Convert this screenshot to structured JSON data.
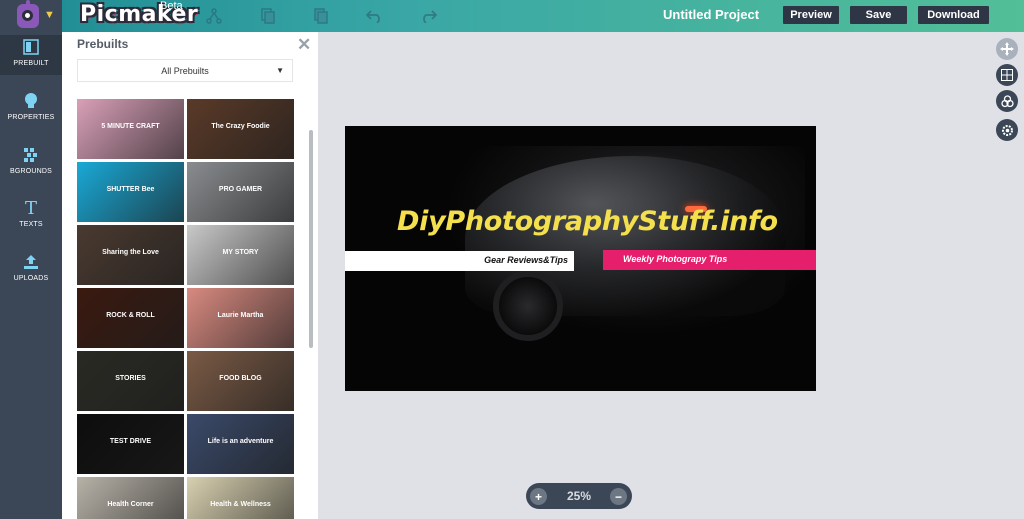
{
  "app": {
    "brand": "Picmaker",
    "badge": "Beta",
    "project_title": "Untitled Project",
    "accent_color": "#52bf98",
    "brand_color": "#3b4756"
  },
  "toolbar": {
    "icons": [
      "share-icon",
      "copy-icon",
      "duplicate-icon",
      "undo-icon",
      "redo-icon"
    ],
    "preview_label": "Preview",
    "save_label": "Save",
    "download_label": "Download"
  },
  "rail": {
    "items": [
      {
        "label": "PREBUILT",
        "icon": "layout-icon",
        "active": true
      },
      {
        "label": "PROPERTIES",
        "icon": "bulb-icon",
        "active": false
      },
      {
        "label": "BGROUNDS",
        "icon": "pattern-icon",
        "active": false
      },
      {
        "label": "TEXTS",
        "icon": "text-icon",
        "active": false
      },
      {
        "label": "UPLOADS",
        "icon": "upload-icon",
        "active": false
      }
    ]
  },
  "panel": {
    "title": "Prebuilts",
    "filter_value": "All Prebuilts",
    "thumbnails": [
      {
        "text": "5 MINUTE CRAFT",
        "bg": "#d9a0b8"
      },
      {
        "text": "The Crazy Foodie",
        "bg": "#5a3a28"
      },
      {
        "text": "SHUTTER Bee",
        "bg": "#1aa9d6"
      },
      {
        "text": "PRO GAMER",
        "bg": "#8a8d90"
      },
      {
        "text": "Sharing the Love",
        "bg": "#4a3a30"
      },
      {
        "text": "MY STORY",
        "bg": "#c9c9c9"
      },
      {
        "text": "ROCK & ROLL",
        "bg": "#3a1a10"
      },
      {
        "text": "Laurie Martha",
        "bg": "#d88a80"
      },
      {
        "text": "STORIES",
        "bg": "#2a2a24"
      },
      {
        "text": "FOOD BLOG",
        "bg": "#7a5a45"
      },
      {
        "text": "TEST DRIVE",
        "bg": "#0d0d0d"
      },
      {
        "text": "Life is an adventure",
        "bg": "#3a4a6a"
      },
      {
        "text": "Health Corner",
        "bg": "#b8b2a8"
      },
      {
        "text": "Health & Wellness",
        "bg": "#d8d0b0"
      }
    ]
  },
  "design": {
    "headline": "DiyPhotographyStuff.info",
    "left_tag": "Gear Reviews&Tips",
    "right_tag": "Weekly Photograpy Tips",
    "headline_color": "#f4e04d",
    "band_color": "#e51f6b"
  },
  "side_tools": [
    "move-icon",
    "grid-icon",
    "color-icon",
    "settings-icon"
  ],
  "zoom": {
    "value": "25%"
  }
}
